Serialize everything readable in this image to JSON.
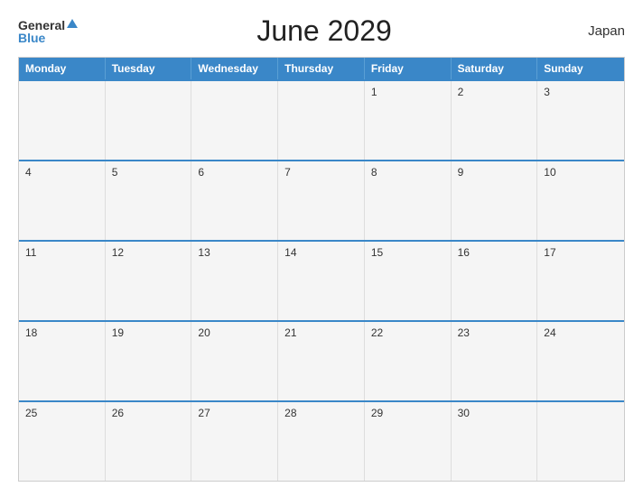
{
  "header": {
    "logo_general": "General",
    "logo_blue": "Blue",
    "title": "June 2029",
    "country": "Japan"
  },
  "weekdays": [
    "Monday",
    "Tuesday",
    "Wednesday",
    "Thursday",
    "Friday",
    "Saturday",
    "Sunday"
  ],
  "weeks": [
    [
      {
        "day": "",
        "empty": true
      },
      {
        "day": "",
        "empty": true
      },
      {
        "day": "",
        "empty": true
      },
      {
        "day": "",
        "empty": true
      },
      {
        "day": "1"
      },
      {
        "day": "2"
      },
      {
        "day": "3"
      }
    ],
    [
      {
        "day": "4"
      },
      {
        "day": "5"
      },
      {
        "day": "6"
      },
      {
        "day": "7"
      },
      {
        "day": "8"
      },
      {
        "day": "9"
      },
      {
        "day": "10"
      }
    ],
    [
      {
        "day": "11"
      },
      {
        "day": "12"
      },
      {
        "day": "13"
      },
      {
        "day": "14"
      },
      {
        "day": "15"
      },
      {
        "day": "16"
      },
      {
        "day": "17"
      }
    ],
    [
      {
        "day": "18"
      },
      {
        "day": "19"
      },
      {
        "day": "20"
      },
      {
        "day": "21"
      },
      {
        "day": "22"
      },
      {
        "day": "23"
      },
      {
        "day": "24"
      }
    ],
    [
      {
        "day": "25"
      },
      {
        "day": "26"
      },
      {
        "day": "27"
      },
      {
        "day": "28"
      },
      {
        "day": "29"
      },
      {
        "day": "30"
      },
      {
        "day": "",
        "empty": true
      }
    ]
  ]
}
